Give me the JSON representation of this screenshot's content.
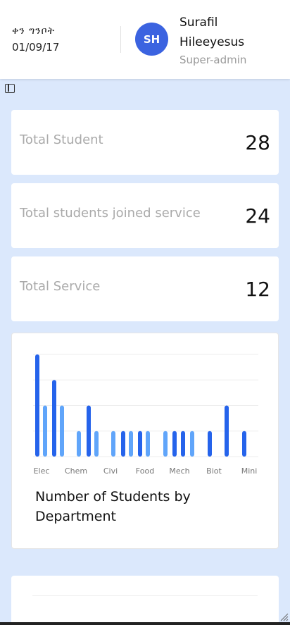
{
  "header": {
    "date_label": "ቀን ግንቦት",
    "date_value": "01/09/17",
    "avatar_initials": "SH",
    "user_first": "Surafil",
    "user_last": "Hileeyesus",
    "user_role": "Super-admin"
  },
  "stats": [
    {
      "label": "Total Student",
      "value": "28"
    },
    {
      "label": "Total students joined service",
      "value": "24"
    },
    {
      "label": "Total Service",
      "value": "12"
    }
  ],
  "chart_data": {
    "type": "bar",
    "title": "Number of Students by Department",
    "xlabel": "",
    "ylabel": "",
    "ylim": [
      0,
      4
    ],
    "grid": true,
    "categories": [
      "Elec",
      "Chem",
      "Civi",
      "Food",
      "Mech",
      "Biot",
      "Mini"
    ],
    "series": [
      {
        "values": [
          4,
          2,
          1,
          1,
          1,
          1,
          1,
          1,
          1,
          1,
          1,
          1,
          1,
          2,
          1
        ],
        "shade": "dark"
      },
      {
        "values": [
          2,
          2,
          1,
          1,
          1,
          1,
          1,
          1,
          1
        ],
        "shade": "light"
      }
    ],
    "bars": [
      {
        "v": 4,
        "c": "#2563eb"
      },
      {
        "v": 2,
        "c": "#60a5fa"
      },
      {
        "v": 3,
        "c": "#2563eb"
      },
      {
        "v": 2,
        "c": "#60a5fa"
      },
      {
        "v": 1,
        "c": "#60a5fa"
      },
      {
        "v": 2,
        "c": "#2563eb"
      },
      {
        "v": 1,
        "c": "#60a5fa"
      },
      {
        "v": 1,
        "c": "#60a5fa"
      },
      {
        "v": 1,
        "c": "#2563eb"
      },
      {
        "v": 1,
        "c": "#60a5fa"
      },
      {
        "v": 1,
        "c": "#2563eb"
      },
      {
        "v": 1,
        "c": "#60a5fa"
      },
      {
        "v": 1,
        "c": "#60a5fa"
      },
      {
        "v": 1,
        "c": "#2563eb"
      },
      {
        "v": 1,
        "c": "#2563eb"
      },
      {
        "v": 1,
        "c": "#60a5fa"
      },
      {
        "v": 1,
        "c": "#2563eb"
      },
      {
        "v": 2,
        "c": "#2563eb"
      },
      {
        "v": 1,
        "c": "#2563eb"
      }
    ]
  },
  "colors": {
    "accent": "#3b63e0",
    "bar_dark": "#2563eb",
    "bar_light": "#60a5fa",
    "page_bg": "#dbe8fc"
  }
}
